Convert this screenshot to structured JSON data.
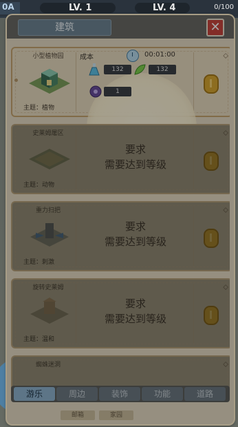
{
  "topbar": {
    "left_label": "0A",
    "level_a": "LV. 1",
    "level_b": "LV. 4",
    "count": "0/100"
  },
  "panel": {
    "title": "建筑",
    "close_icon": "close-icon"
  },
  "cards": [
    {
      "name": "小型植物园",
      "theme": "主题：植物",
      "cost_label": "成本",
      "time": "00:01:00",
      "resources": [
        {
          "icon": "flask-icon",
          "value": "132"
        },
        {
          "icon": "leaf-icon",
          "value": "132"
        },
        {
          "icon": "gem-icon",
          "value": "1"
        }
      ],
      "locked": false
    },
    {
      "name": "史莱姆屠区",
      "theme": "主题：动物",
      "req_title": "要求",
      "req_text": "需要达到等级",
      "locked": true
    },
    {
      "name": "重力扫把",
      "theme": "主题：刺激",
      "req_title": "要求",
      "req_text": "需要达到等级",
      "locked": true
    },
    {
      "name": "旋转史莱姆",
      "theme": "主题：温和",
      "req_title": "要求",
      "req_text": "需要达到等级",
      "locked": true
    },
    {
      "name": "蜘蛛迷洞",
      "locked": true
    }
  ],
  "tabs": [
    "游乐",
    "周边",
    "装饰",
    "功能",
    "道路"
  ],
  "footer": [
    "邮箱",
    "家园"
  ],
  "colors": {
    "accent_tab": "#8fb4d0",
    "close": "#c9453e",
    "coin": "#d9a832"
  }
}
